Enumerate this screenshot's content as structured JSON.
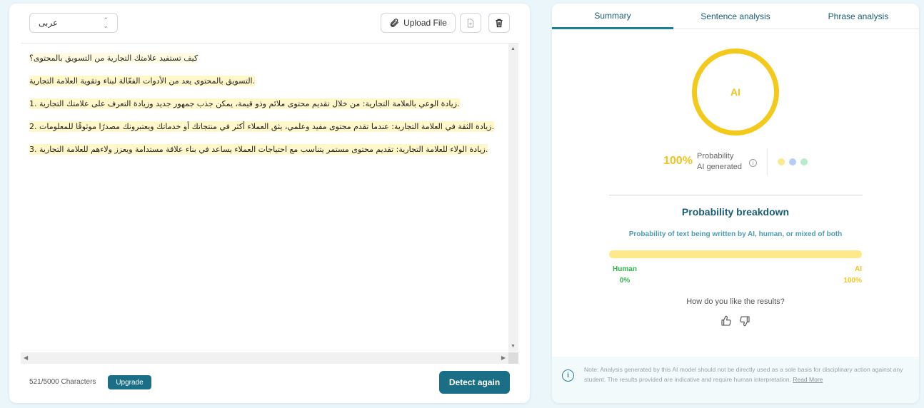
{
  "editor": {
    "language_select": "عربى",
    "upload_label": "Upload File",
    "lines": [
      "كيف تستفيد علامتك التجارية من التسويق بالمحتوى؟",
      "التسويق بالمحتوى يعد من الأدوات الفعّالة لبناء وتقوية العلامة التجارية.",
      "1. زيادة الوعي بالعلامة التجارية: من خلال تقديم محتوى ملائم وذو قيمة، يمكن جذب جمهور جديد وزيادة التعرف على علامتك التجارية.",
      "2. زيادة الثقة في العلامة التجارية: عندما تقدم محتوى مفيد وعلمي، يثق العملاء أكثر في منتجاتك أو خدماتك ويعتبرونك مصدرًا موثوقًا للمعلومات.",
      "3. زيادة الولاء للعلامة التجارية: تقديم محتوى مستمر يتناسب مع احتياجات العملاء يساعد في بناء علاقة مستدامة ويعزز ولاءهم للعلامة التجارية."
    ],
    "char_count": "521/5000 Characters",
    "upgrade_label": "Upgrade",
    "detect_label": "Detect again"
  },
  "results": {
    "tabs": [
      "Summary",
      "Sentence analysis",
      "Phrase analysis"
    ],
    "active_tab": "Summary",
    "ring_label": "AI",
    "percent": "100%",
    "prob_line1": "Probability",
    "prob_line2": "AI generated",
    "breakdown_title": "Probability breakdown",
    "breakdown_subtitle": "Probability of text being written by AI, human, or mixed of both",
    "human_label": "Human",
    "human_value": "0%",
    "ai_label": "AI",
    "ai_value": "100%",
    "feedback_question": "How do you like the results?",
    "note": "Note: Analysis generated by this AI model should not be directly used as a sole basis for disciplinary action against any student. The results provided are indicative and require human interpretation.",
    "read_more": "Read More"
  },
  "colors": {
    "accent": "#1a6f86",
    "ai_yellow": "#f3c91c",
    "human_green": "#2fb54a",
    "mixed_blue": "#b7cdf7"
  },
  "icons": [
    "chevron-updown-icon",
    "paperclip-icon",
    "document-icon",
    "trash-icon",
    "info-icon",
    "thumbs-up-icon",
    "thumbs-down-icon"
  ]
}
